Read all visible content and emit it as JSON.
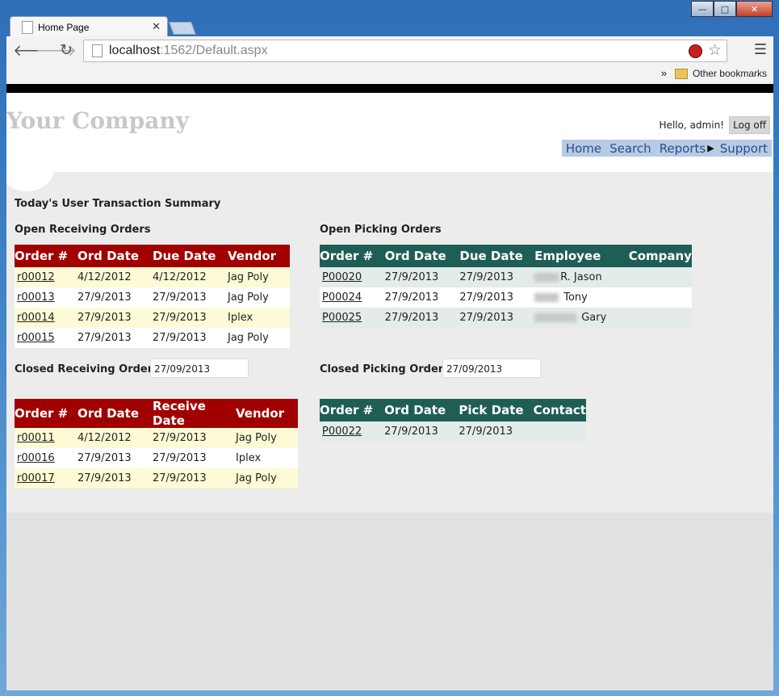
{
  "browser": {
    "tab_title": "Home Page",
    "url_host": "localhost",
    "url_path": ":1562/Default.aspx",
    "bookmarks_more": "»",
    "other_bookmarks": "Other bookmarks"
  },
  "header": {
    "logo": "Your Company",
    "greeting": "Hello, admin!",
    "logoff": "Log off",
    "menu": [
      "Home",
      "Search",
      "Reports",
      "Support"
    ]
  },
  "summary_title": "Today's User Transaction Summary",
  "open_receiving": {
    "title": "Open Receiving Orders",
    "columns": [
      "Order #",
      "Ord Date",
      "Due Date",
      "Vendor"
    ],
    "rows": [
      [
        "r00012",
        "4/12/2012",
        "4/12/2012",
        "Jag Poly"
      ],
      [
        "r00013",
        "27/9/2013",
        "27/9/2013",
        "Jag Poly"
      ],
      [
        "r00014",
        "27/9/2013",
        "27/9/2013",
        "Iplex"
      ],
      [
        "r00015",
        "27/9/2013",
        "27/9/2013",
        "Jag Poly"
      ]
    ]
  },
  "open_picking": {
    "title": "Open Picking Orders",
    "columns": [
      "Order #",
      "Ord Date",
      "Due Date",
      "Employee",
      "Company"
    ],
    "rows": [
      [
        "P00020",
        "27/9/2013",
        "27/9/2013",
        "R. Jason",
        ""
      ],
      [
        "P00024",
        "27/9/2013",
        "27/9/2013",
        "Tony",
        ""
      ],
      [
        "P00025",
        "27/9/2013",
        "27/9/2013",
        "Gary",
        ""
      ]
    ]
  },
  "closed_receiving": {
    "title": "Closed Receiving Orders",
    "date": "27/09/2013",
    "columns": [
      "Order #",
      "Ord Date",
      "Receive Date",
      "Vendor"
    ],
    "rows": [
      [
        "r00011",
        "4/12/2012",
        "27/9/2013",
        "Jag Poly"
      ],
      [
        "r00016",
        "27/9/2013",
        "27/9/2013",
        "Iplex"
      ],
      [
        "r00017",
        "27/9/2013",
        "27/9/2013",
        "Jag Poly"
      ]
    ]
  },
  "closed_picking": {
    "title": "Closed Picking Orders",
    "date": "27/09/2013",
    "columns": [
      "Order #",
      "Ord Date",
      "Pick Date",
      "Contact"
    ],
    "rows": [
      [
        "P00022",
        "27/9/2013",
        "27/9/2013",
        ""
      ]
    ]
  }
}
